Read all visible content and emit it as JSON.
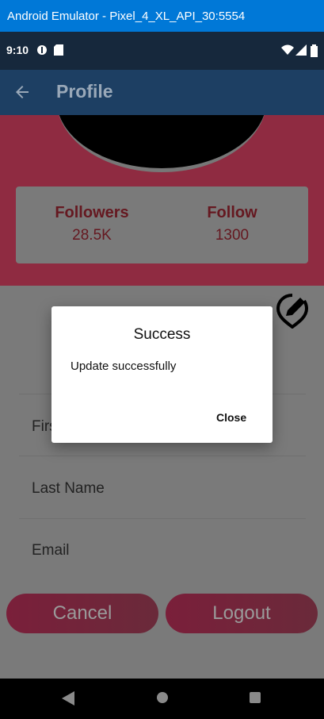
{
  "window": {
    "title": "Android Emulator - Pixel_4_XL_API_30:5554"
  },
  "status_bar": {
    "time": "9:10",
    "left_icons": [
      "data-saver-icon",
      "sd-card-icon"
    ],
    "right_icons": [
      "wifi-icon",
      "signal-icon",
      "battery-icon"
    ]
  },
  "app_bar": {
    "title": "Profile",
    "back_icon": "arrow-back-icon"
  },
  "stats": {
    "followers_label": "Followers",
    "followers_value": "28.5K",
    "follow_label": "Follow",
    "follow_value": "1300"
  },
  "fields": {
    "first_name": "First Name",
    "last_name": "Last Name",
    "email": "Email"
  },
  "buttons": {
    "cancel": "Cancel",
    "logout": "Logout"
  },
  "dialog": {
    "title": "Success",
    "message": "Update successfully",
    "close": "Close"
  },
  "colors": {
    "brand_pink": "#e0306a",
    "title_blue": "#0078d7",
    "app_bar": "#1565c0"
  }
}
